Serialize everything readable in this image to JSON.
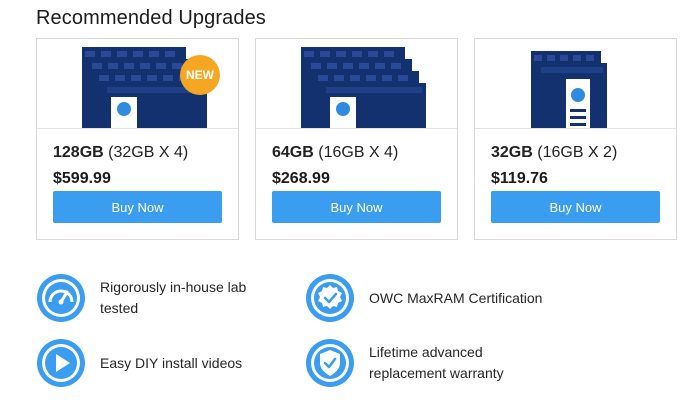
{
  "section": {
    "title": "Recommended Upgrades"
  },
  "products": [
    {
      "capacity": "128GB",
      "config": "(32GB X 4)",
      "price": "$599.99",
      "button": "Buy Now",
      "badge": "NEW",
      "modules": 4
    },
    {
      "capacity": "64GB",
      "config": "(16GB X 4)",
      "price": "$268.99",
      "button": "Buy Now",
      "badge": "",
      "modules": 4
    },
    {
      "capacity": "32GB",
      "config": "(16GB X 2)",
      "price": "$119.76",
      "button": "Buy Now",
      "badge": "",
      "modules": 2
    }
  ],
  "features": [
    {
      "icon": "gauge-icon",
      "text": "Rigorously in-house lab tested"
    },
    {
      "icon": "certification-badge-icon",
      "text": "OWC MaxRAM Certification"
    },
    {
      "icon": "play-icon",
      "text": "Easy DIY install videos"
    },
    {
      "icon": "shield-check-icon",
      "text": "Lifetime advanced replacement warranty"
    }
  ],
  "colors": {
    "button": "#3b9df0",
    "badge": "#f5a623",
    "icon": "#3b9df0",
    "ram_board": "#13306f"
  }
}
